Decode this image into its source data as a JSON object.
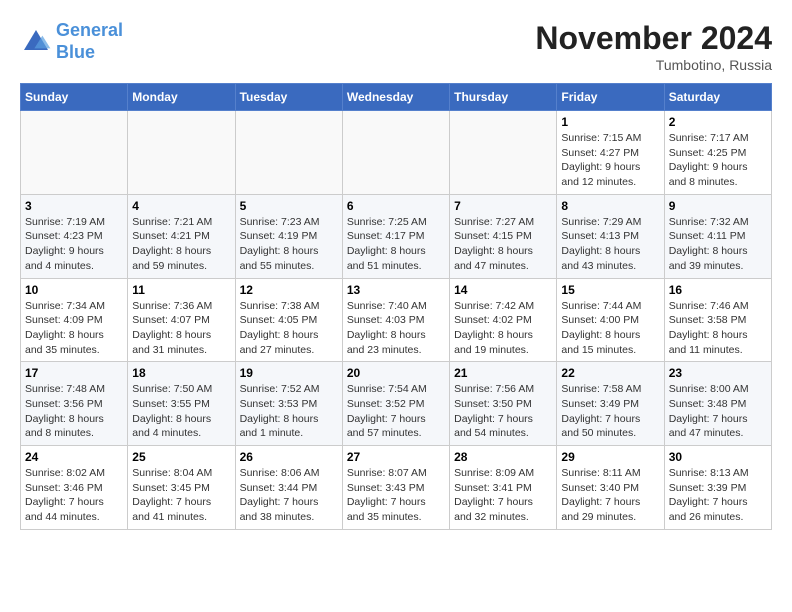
{
  "logo": {
    "line1": "General",
    "line2": "Blue"
  },
  "title": "November 2024",
  "location": "Tumbotino, Russia",
  "days_header": [
    "Sunday",
    "Monday",
    "Tuesday",
    "Wednesday",
    "Thursday",
    "Friday",
    "Saturday"
  ],
  "weeks": [
    [
      {
        "day": "",
        "sunrise": "",
        "sunset": "",
        "daylight": ""
      },
      {
        "day": "",
        "sunrise": "",
        "sunset": "",
        "daylight": ""
      },
      {
        "day": "",
        "sunrise": "",
        "sunset": "",
        "daylight": ""
      },
      {
        "day": "",
        "sunrise": "",
        "sunset": "",
        "daylight": ""
      },
      {
        "day": "",
        "sunrise": "",
        "sunset": "",
        "daylight": ""
      },
      {
        "day": "1",
        "sunrise": "Sunrise: 7:15 AM",
        "sunset": "Sunset: 4:27 PM",
        "daylight": "Daylight: 9 hours and 12 minutes."
      },
      {
        "day": "2",
        "sunrise": "Sunrise: 7:17 AM",
        "sunset": "Sunset: 4:25 PM",
        "daylight": "Daylight: 9 hours and 8 minutes."
      }
    ],
    [
      {
        "day": "3",
        "sunrise": "Sunrise: 7:19 AM",
        "sunset": "Sunset: 4:23 PM",
        "daylight": "Daylight: 9 hours and 4 minutes."
      },
      {
        "day": "4",
        "sunrise": "Sunrise: 7:21 AM",
        "sunset": "Sunset: 4:21 PM",
        "daylight": "Daylight: 8 hours and 59 minutes."
      },
      {
        "day": "5",
        "sunrise": "Sunrise: 7:23 AM",
        "sunset": "Sunset: 4:19 PM",
        "daylight": "Daylight: 8 hours and 55 minutes."
      },
      {
        "day": "6",
        "sunrise": "Sunrise: 7:25 AM",
        "sunset": "Sunset: 4:17 PM",
        "daylight": "Daylight: 8 hours and 51 minutes."
      },
      {
        "day": "7",
        "sunrise": "Sunrise: 7:27 AM",
        "sunset": "Sunset: 4:15 PM",
        "daylight": "Daylight: 8 hours and 47 minutes."
      },
      {
        "day": "8",
        "sunrise": "Sunrise: 7:29 AM",
        "sunset": "Sunset: 4:13 PM",
        "daylight": "Daylight: 8 hours and 43 minutes."
      },
      {
        "day": "9",
        "sunrise": "Sunrise: 7:32 AM",
        "sunset": "Sunset: 4:11 PM",
        "daylight": "Daylight: 8 hours and 39 minutes."
      }
    ],
    [
      {
        "day": "10",
        "sunrise": "Sunrise: 7:34 AM",
        "sunset": "Sunset: 4:09 PM",
        "daylight": "Daylight: 8 hours and 35 minutes."
      },
      {
        "day": "11",
        "sunrise": "Sunrise: 7:36 AM",
        "sunset": "Sunset: 4:07 PM",
        "daylight": "Daylight: 8 hours and 31 minutes."
      },
      {
        "day": "12",
        "sunrise": "Sunrise: 7:38 AM",
        "sunset": "Sunset: 4:05 PM",
        "daylight": "Daylight: 8 hours and 27 minutes."
      },
      {
        "day": "13",
        "sunrise": "Sunrise: 7:40 AM",
        "sunset": "Sunset: 4:03 PM",
        "daylight": "Daylight: 8 hours and 23 minutes."
      },
      {
        "day": "14",
        "sunrise": "Sunrise: 7:42 AM",
        "sunset": "Sunset: 4:02 PM",
        "daylight": "Daylight: 8 hours and 19 minutes."
      },
      {
        "day": "15",
        "sunrise": "Sunrise: 7:44 AM",
        "sunset": "Sunset: 4:00 PM",
        "daylight": "Daylight: 8 hours and 15 minutes."
      },
      {
        "day": "16",
        "sunrise": "Sunrise: 7:46 AM",
        "sunset": "Sunset: 3:58 PM",
        "daylight": "Daylight: 8 hours and 11 minutes."
      }
    ],
    [
      {
        "day": "17",
        "sunrise": "Sunrise: 7:48 AM",
        "sunset": "Sunset: 3:56 PM",
        "daylight": "Daylight: 8 hours and 8 minutes."
      },
      {
        "day": "18",
        "sunrise": "Sunrise: 7:50 AM",
        "sunset": "Sunset: 3:55 PM",
        "daylight": "Daylight: 8 hours and 4 minutes."
      },
      {
        "day": "19",
        "sunrise": "Sunrise: 7:52 AM",
        "sunset": "Sunset: 3:53 PM",
        "daylight": "Daylight: 8 hours and 1 minute."
      },
      {
        "day": "20",
        "sunrise": "Sunrise: 7:54 AM",
        "sunset": "Sunset: 3:52 PM",
        "daylight": "Daylight: 7 hours and 57 minutes."
      },
      {
        "day": "21",
        "sunrise": "Sunrise: 7:56 AM",
        "sunset": "Sunset: 3:50 PM",
        "daylight": "Daylight: 7 hours and 54 minutes."
      },
      {
        "day": "22",
        "sunrise": "Sunrise: 7:58 AM",
        "sunset": "Sunset: 3:49 PM",
        "daylight": "Daylight: 7 hours and 50 minutes."
      },
      {
        "day": "23",
        "sunrise": "Sunrise: 8:00 AM",
        "sunset": "Sunset: 3:48 PM",
        "daylight": "Daylight: 7 hours and 47 minutes."
      }
    ],
    [
      {
        "day": "24",
        "sunrise": "Sunrise: 8:02 AM",
        "sunset": "Sunset: 3:46 PM",
        "daylight": "Daylight: 7 hours and 44 minutes."
      },
      {
        "day": "25",
        "sunrise": "Sunrise: 8:04 AM",
        "sunset": "Sunset: 3:45 PM",
        "daylight": "Daylight: 7 hours and 41 minutes."
      },
      {
        "day": "26",
        "sunrise": "Sunrise: 8:06 AM",
        "sunset": "Sunset: 3:44 PM",
        "daylight": "Daylight: 7 hours and 38 minutes."
      },
      {
        "day": "27",
        "sunrise": "Sunrise: 8:07 AM",
        "sunset": "Sunset: 3:43 PM",
        "daylight": "Daylight: 7 hours and 35 minutes."
      },
      {
        "day": "28",
        "sunrise": "Sunrise: 8:09 AM",
        "sunset": "Sunset: 3:41 PM",
        "daylight": "Daylight: 7 hours and 32 minutes."
      },
      {
        "day": "29",
        "sunrise": "Sunrise: 8:11 AM",
        "sunset": "Sunset: 3:40 PM",
        "daylight": "Daylight: 7 hours and 29 minutes."
      },
      {
        "day": "30",
        "sunrise": "Sunrise: 8:13 AM",
        "sunset": "Sunset: 3:39 PM",
        "daylight": "Daylight: 7 hours and 26 minutes."
      }
    ]
  ]
}
